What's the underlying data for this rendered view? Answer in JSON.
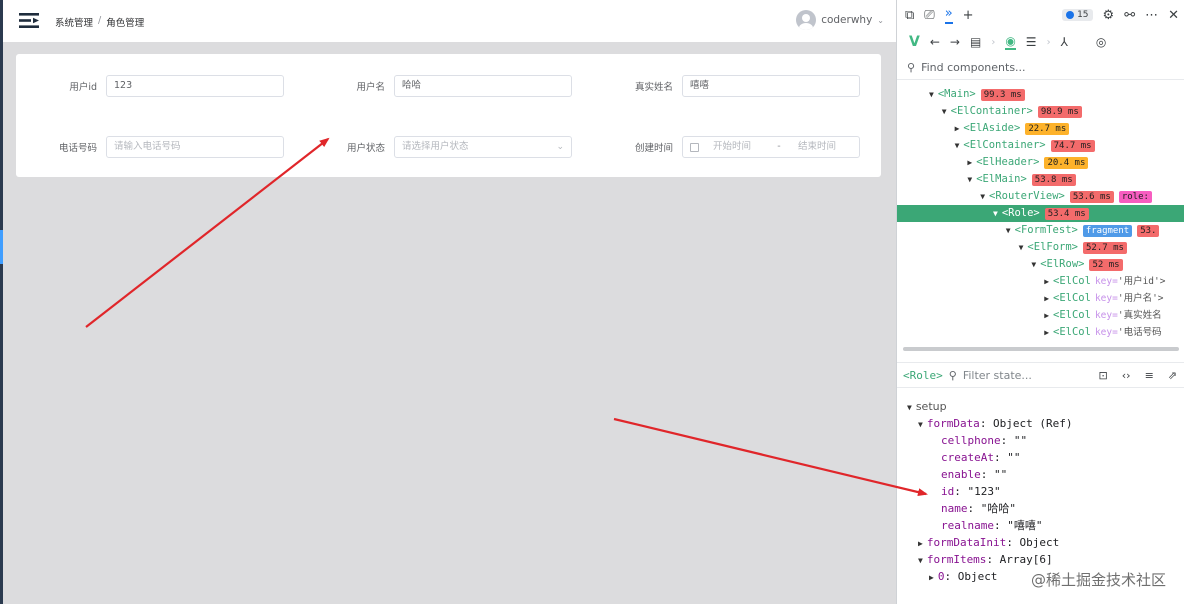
{
  "header": {
    "breadcrumb": [
      "系统管理",
      "角色管理"
    ],
    "breadcrumb_separator": "/",
    "username": "coderwhy",
    "chevron": "⌄"
  },
  "form": {
    "fields": [
      {
        "label": "用户id",
        "value": "123",
        "placeholder": ""
      },
      {
        "label": "用户名",
        "value": "哈哈",
        "placeholder": ""
      },
      {
        "label": "真实姓名",
        "value": "嘻嘻",
        "placeholder": ""
      },
      {
        "label": "电话号码",
        "value": "",
        "placeholder": "请输入电话号码"
      },
      {
        "label": "用户状态",
        "value": "",
        "placeholder": "请选择用户状态"
      },
      {
        "label": "创建时间",
        "value": "",
        "start_placeholder": "开始时间",
        "range_separator": "-",
        "end_placeholder": "结束时间"
      }
    ]
  },
  "devtools": {
    "toolbar": {
      "more_tabs": "»",
      "add": "+",
      "issues_count": "15",
      "menu": "⋯",
      "close": "✕"
    },
    "vue_toolbar": {
      "back": "←",
      "forward": "→"
    },
    "find_placeholder": "Find components...",
    "tree": [
      {
        "indent": 0,
        "name": "<Main>",
        "badges": [
          {
            "text": "99.3 ms",
            "color": "red"
          }
        ]
      },
      {
        "indent": 1,
        "name": "<ElContainer>",
        "badges": [
          {
            "text": "98.9 ms",
            "color": "red"
          }
        ]
      },
      {
        "indent": 2,
        "name": "<ElAside>",
        "badges": [
          {
            "text": "22.7 ms",
            "color": "orange"
          }
        ],
        "collapsed": true
      },
      {
        "indent": 2,
        "name": "<ElContainer>",
        "badges": [
          {
            "text": "74.7 ms",
            "color": "red"
          }
        ]
      },
      {
        "indent": 3,
        "name": "<ElHeader>",
        "badges": [
          {
            "text": "20.4 ms",
            "color": "orange"
          }
        ],
        "collapsed": true
      },
      {
        "indent": 3,
        "name": "<ElMain>",
        "badges": [
          {
            "text": "53.8 ms",
            "color": "red"
          }
        ]
      },
      {
        "indent": 4,
        "name": "<RouterView>",
        "badges": [
          {
            "text": "53.6 ms",
            "color": "red"
          },
          {
            "text": "role:",
            "color": "pink"
          }
        ]
      },
      {
        "indent": 5,
        "name": "<Role>",
        "badges": [
          {
            "text": "53.4 ms",
            "color": "red"
          }
        ],
        "selected": true
      },
      {
        "indent": 6,
        "name": "<FormTest>",
        "badges": [
          {
            "text": "fragment",
            "color": "blue"
          },
          {
            "text": "53.",
            "color": "red"
          }
        ]
      },
      {
        "indent": 7,
        "name": "<ElForm>",
        "badges": [
          {
            "text": "52.7 ms",
            "color": "red"
          }
        ]
      },
      {
        "indent": 8,
        "name": "<ElRow>",
        "badges": [
          {
            "text": "52 ms",
            "color": "red"
          }
        ]
      },
      {
        "indent": 9,
        "name": "<ElCol",
        "key": "key=",
        "keyval": "'用户id'>",
        "collapsed": true
      },
      {
        "indent": 9,
        "name": "<ElCol",
        "key": "key=",
        "keyval": "'用户名'>",
        "collapsed": true
      },
      {
        "indent": 9,
        "name": "<ElCol",
        "key": "key=",
        "keyval": "'真实姓名",
        "collapsed": true
      },
      {
        "indent": 9,
        "name": "<ElCol",
        "key": "key=",
        "keyval": "'电话号码",
        "collapsed": true
      }
    ],
    "state_bar": {
      "component": "<Role>",
      "filter_placeholder": "Filter state..."
    },
    "state": [
      {
        "indent": 0,
        "kind": "section",
        "text": "setup",
        "toggle": "▼"
      },
      {
        "indent": 1,
        "key": "formData",
        "value": ": Object (Ref)",
        "toggle": "▼"
      },
      {
        "indent": 2,
        "key": "cellphone",
        "value": ": \"\""
      },
      {
        "indent": 2,
        "key": "createAt",
        "value": ": \"\""
      },
      {
        "indent": 2,
        "key": "enable",
        "value": ": \"\""
      },
      {
        "indent": 2,
        "key": "id",
        "value": ": \"123\""
      },
      {
        "indent": 2,
        "key": "name",
        "value": ": \"哈哈\""
      },
      {
        "indent": 2,
        "key": "realname",
        "value": ": \"嘻嘻\""
      },
      {
        "indent": 1,
        "key": "formDataInit",
        "value": ": Object",
        "toggle": "▶"
      },
      {
        "indent": 1,
        "key": "formItems",
        "value": ": Array[6]",
        "toggle": "▼"
      },
      {
        "indent": 2,
        "key": "0",
        "value": ": Object",
        "toggle": "▶"
      }
    ],
    "watermark": "@稀土掘金技术社区"
  },
  "colors": {
    "vue_green": "#3ba776",
    "badge_red": "#f36b6b",
    "badge_orange": "#fdb22b",
    "badge_blue": "#4f9ae8",
    "badge_pink": "#f75dc0",
    "arrow_red": "#e0262a"
  },
  "icons": [
    "menu-fold-icon",
    "avatar-icon",
    "calendar-icon",
    "select-arrow-icon",
    "screencast-icon",
    "device-toolbar-icon",
    "settings-gear-icon",
    "customize-icon",
    "vue-logo-icon",
    "components-compass-icon",
    "timeline-icon",
    "routes-icon",
    "target-icon",
    "search-icon",
    "scroll-to-icon",
    "code-icon",
    "list-icon",
    "open-in-editor-icon"
  ]
}
